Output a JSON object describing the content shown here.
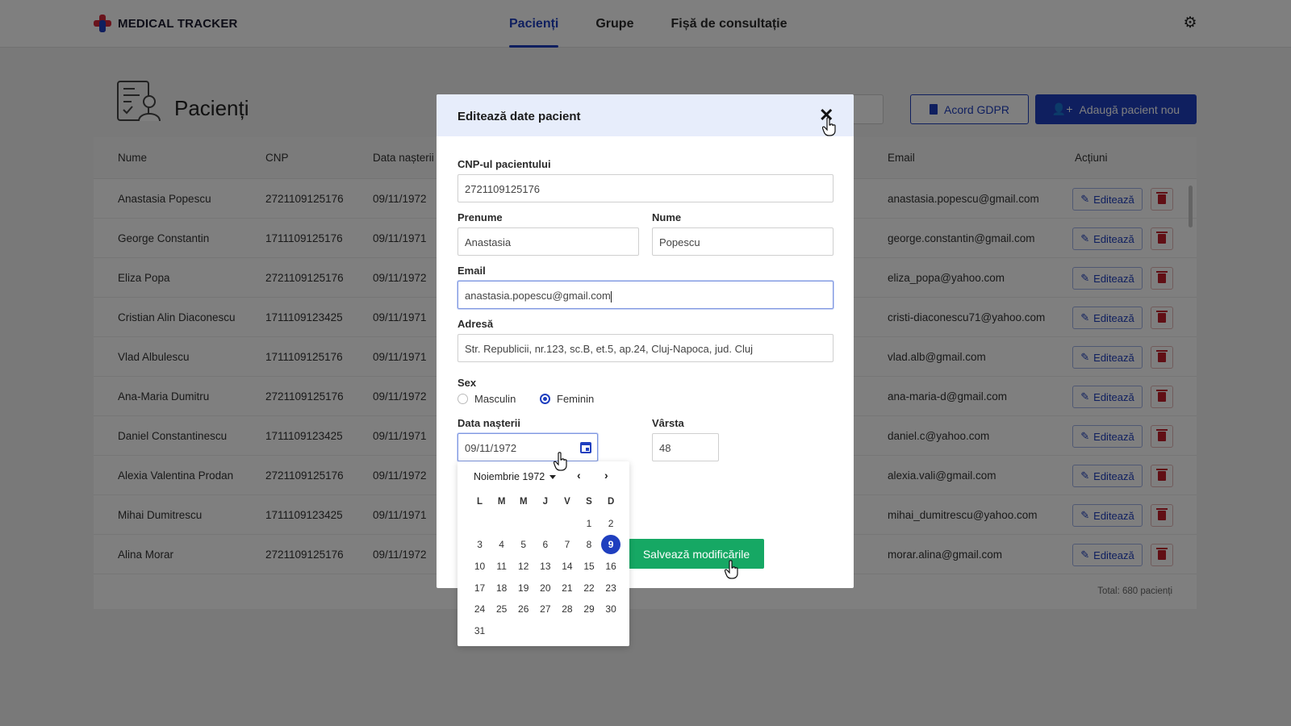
{
  "app": {
    "name": "MEDICAL TRACKER"
  },
  "nav": [
    {
      "label": "Pacienți",
      "active": true
    },
    {
      "label": "Grupe",
      "active": false
    },
    {
      "label": "Fișă de consultație",
      "active": false
    }
  ],
  "page": {
    "title": "Pacienți",
    "gdpr_button": "Acord GDPR",
    "add_button": "Adaugă pacient nou"
  },
  "table": {
    "headers": {
      "name": "Nume",
      "cnp": "CNP",
      "dob": "Data nașterii",
      "email": "Email",
      "actions": "Acțiuni"
    },
    "edit_label": "Editează",
    "rows": [
      {
        "name": "Anastasia Popescu",
        "cnp": "2721109125176",
        "dob": "09/11/1972",
        "email": "anastasia.popescu@gmail.com"
      },
      {
        "name": "George Constantin",
        "cnp": "1711109125176",
        "dob": "09/11/1971",
        "email": "george.constantin@gmail.com"
      },
      {
        "name": "Eliza Popa",
        "cnp": "2721109125176",
        "dob": "09/11/1972",
        "email": "eliza_popa@yahoo.com"
      },
      {
        "name": "Cristian Alin Diaconescu",
        "cnp": "1711109123425",
        "dob": "09/11/1971",
        "email": "cristi-diaconescu71@yahoo.com"
      },
      {
        "name": "Vlad Albulescu",
        "cnp": "1711109125176",
        "dob": "09/11/1971",
        "email": "vlad.alb@gmail.com"
      },
      {
        "name": "Ana-Maria Dumitru",
        "cnp": "2721109125176",
        "dob": "09/11/1972",
        "email": "ana-maria-d@gmail.com"
      },
      {
        "name": "Daniel Constantinescu",
        "cnp": "1711109123425",
        "dob": "09/11/1971",
        "email": "daniel.c@yahoo.com"
      },
      {
        "name": "Alexia Valentina Prodan",
        "cnp": "2721109125176",
        "dob": "09/11/1972",
        "email": "alexia.vali@gmail.com"
      },
      {
        "name": "Mihai Dumitrescu",
        "cnp": "1711109123425",
        "dob": "09/11/1971",
        "email": "mihai_dumitrescu@yahoo.com"
      },
      {
        "name": "Alina Morar",
        "cnp": "2721109125176",
        "dob": "09/11/1972",
        "email": "morar.alina@gmail.com"
      }
    ],
    "total": "Total: 680 pacienți"
  },
  "modal": {
    "title": "Editează date pacient",
    "close": "✕",
    "cnp_label": "CNP-ul pacientului",
    "cnp_value": "2721109125176",
    "first_name_label": "Prenume",
    "first_name_value": "Anastasia",
    "last_name_label": "Nume",
    "last_name_value": "Popescu",
    "email_label": "Email",
    "email_value": "anastasia.popescu@gmail.com",
    "address_label": "Adresă",
    "address_value": "Str. Republicii, nr.123, sc.B, et.5, ap.24, Cluj-Napoca, jud. Cluj",
    "sex_label": "Sex",
    "sex_options": [
      "Masculin",
      "Feminin"
    ],
    "sex_selected": "Feminin",
    "dob_label": "Data nașterii",
    "dob_value": "09/11/1972",
    "age_label": "Vârsta",
    "age_value": "48",
    "save_button": "Salvează modificările"
  },
  "datepicker": {
    "month_label": "Noiembrie 1972",
    "prev": "‹",
    "next": "›",
    "weekdays": [
      "L",
      "M",
      "M",
      "J",
      "V",
      "S",
      "D"
    ],
    "weeks": [
      [
        "",
        "",
        "",
        "",
        "",
        "1",
        "2"
      ],
      [
        "3",
        "4",
        "5",
        "6",
        "7",
        "8",
        "9"
      ],
      [
        "10",
        "11",
        "12",
        "13",
        "14",
        "15",
        "16"
      ],
      [
        "17",
        "18",
        "19",
        "20",
        "21",
        "22",
        "23"
      ],
      [
        "24",
        "25",
        "26",
        "27",
        "28",
        "29",
        "30"
      ],
      [
        "31",
        "",
        "",
        "",
        "",
        "",
        ""
      ]
    ],
    "selected_day": "9"
  },
  "colors": {
    "primary": "#1f3fbf",
    "success": "#16a864",
    "danger": "#c21f2a",
    "logo_red": "#d4283a",
    "logo_blue": "#1f3fbf"
  },
  "icons": [
    "logo-cross-icon",
    "gear-icon",
    "patients-list-icon",
    "document-icon",
    "add-user-icon",
    "pencil-icon",
    "trash-icon",
    "calendar-icon",
    "close-icon",
    "hand-cursor-icon"
  ]
}
